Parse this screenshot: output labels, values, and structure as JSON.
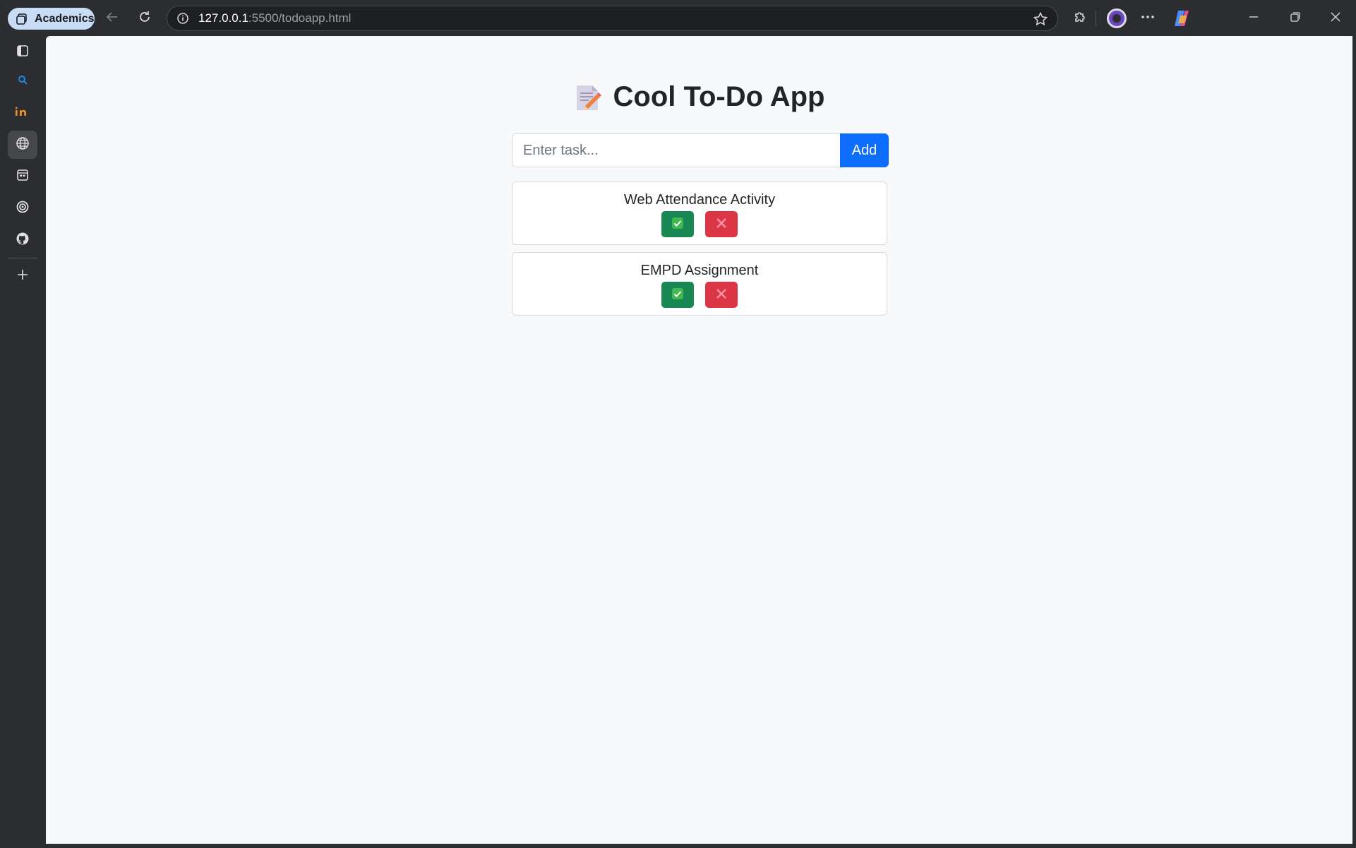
{
  "browser": {
    "profile_label": "Academics",
    "url_host": "127.0.0.1",
    "url_rest": ":5500/todoapp.html"
  },
  "sidebar": {
    "items": [
      {
        "name": "tab-panel-icon",
        "active": false
      },
      {
        "name": "search-icon",
        "active": false
      },
      {
        "name": "brand-in-icon",
        "active": false
      },
      {
        "name": "globe-icon",
        "active": true
      },
      {
        "name": "calendar-icon",
        "active": false
      },
      {
        "name": "openai-icon",
        "active": false
      },
      {
        "name": "github-icon",
        "active": false
      },
      {
        "name": "add-icon",
        "active": false
      }
    ]
  },
  "app": {
    "title": "Cool To-Do App",
    "title_icon": "memo-icon",
    "input_placeholder": "Enter task...",
    "add_label": "Add",
    "tasks": [
      {
        "text": "Web Attendance Activity"
      },
      {
        "text": "EMPD Assignment"
      }
    ]
  },
  "colors": {
    "add_button": "#0d6efd",
    "done_button": "#198754",
    "delete_button": "#dc3545",
    "page_bg": "#f8f9fa",
    "chrome_bg": "#2b2d30"
  }
}
